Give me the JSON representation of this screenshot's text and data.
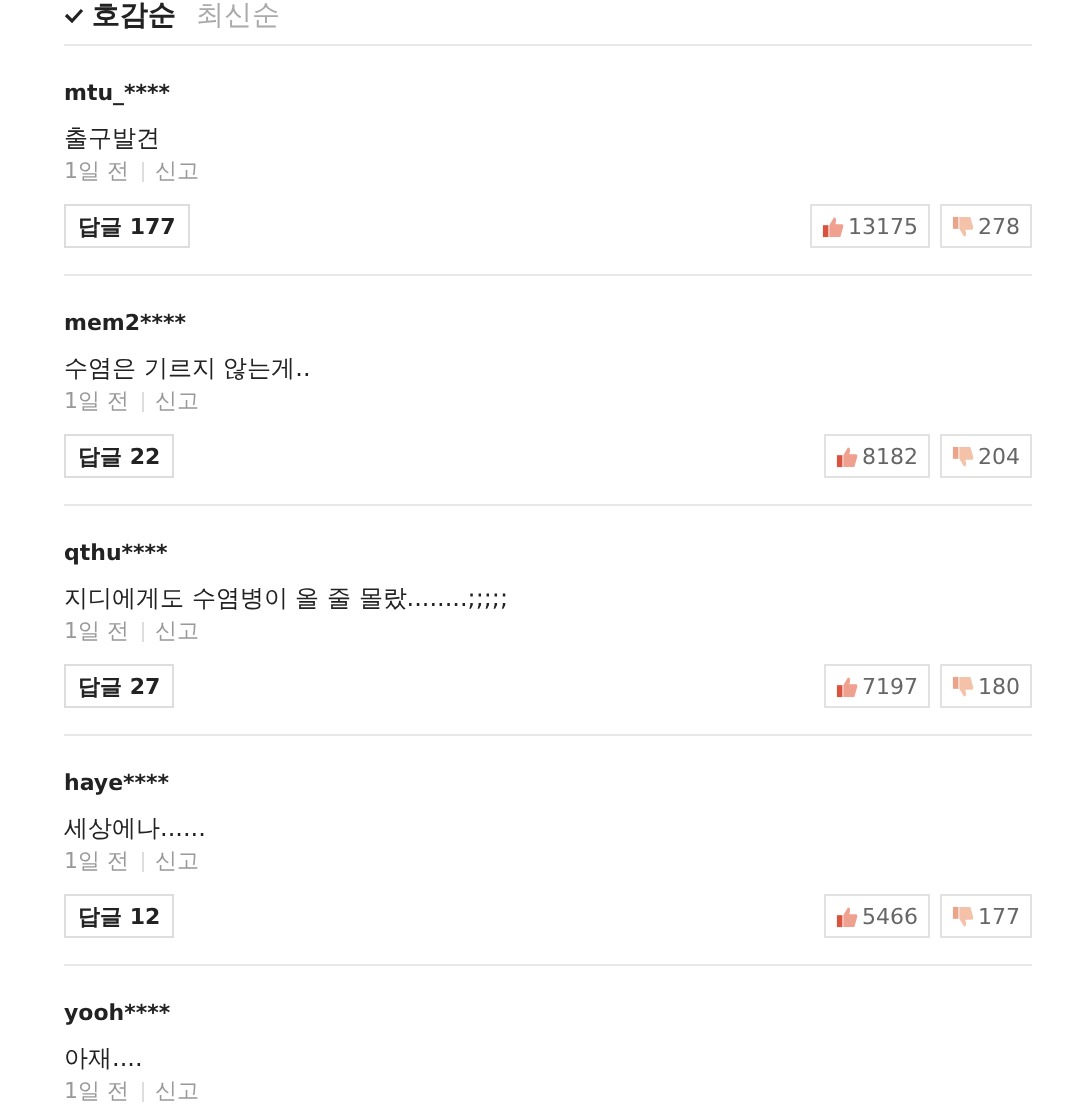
{
  "sort_tabs": [
    {
      "label": "호감순",
      "selected": true
    },
    {
      "label": "최신순",
      "selected": false
    }
  ],
  "comments": [
    {
      "user": "mtu_****",
      "text": "출구발견",
      "time": "1일 전",
      "report": "신고",
      "reply_label": "답글",
      "reply_count": "177",
      "likes": "13175",
      "dislikes": "278"
    },
    {
      "user": "mem2****",
      "text": "수염은 기르지 않는게..",
      "time": "1일 전",
      "report": "신고",
      "reply_label": "답글",
      "reply_count": "22",
      "likes": "8182",
      "dislikes": "204"
    },
    {
      "user": "qthu****",
      "text": "지디에게도 수염병이 올 줄 몰랐........;;;;;",
      "time": "1일 전",
      "report": "신고",
      "reply_label": "답글",
      "reply_count": "27",
      "likes": "7197",
      "dislikes": "180"
    },
    {
      "user": "haye****",
      "text": "세상에나......",
      "time": "1일 전",
      "report": "신고",
      "reply_label": "답글",
      "reply_count": "12",
      "likes": "5466",
      "dislikes": "177"
    },
    {
      "user": "yooh****",
      "text": "아재....",
      "time": "1일 전",
      "report": "신고"
    }
  ]
}
